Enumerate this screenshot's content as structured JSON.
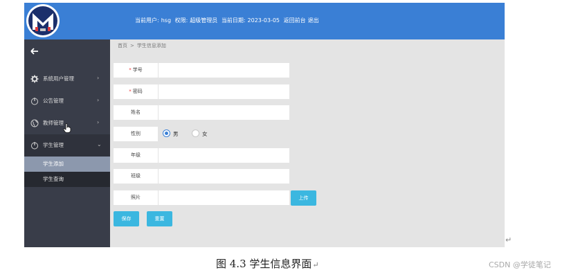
{
  "header": {
    "current_user_label": "当前用户:",
    "current_user": "hsg",
    "role_label": "权限:",
    "role": "超级管理员",
    "date_label": "当前日期:",
    "date": "2023-03-05",
    "back_front_link": "返回前台",
    "logout_link": "退出",
    "header_color": "#3a7fd5"
  },
  "sidebar": {
    "back_icon": "arrow-left-icon",
    "items": [
      {
        "label": "系统用户管理",
        "icon": "gear-icon",
        "arrow": "›"
      },
      {
        "label": "公告管理",
        "icon": "power-icon",
        "arrow": "›"
      },
      {
        "label": "教师管理",
        "icon": "globe-icon",
        "arrow": "›"
      },
      {
        "label": "学生管理",
        "icon": "power-icon",
        "arrow": "⌄"
      }
    ],
    "subitems": [
      {
        "label": "学生添加",
        "active": true
      },
      {
        "label": "学生查询",
        "active": false
      }
    ]
  },
  "breadcrumb": {
    "home": "首页",
    "separator": ">",
    "current": "学生信息添加"
  },
  "form": {
    "student_no": {
      "label": "学号",
      "required": true,
      "value": ""
    },
    "password": {
      "label": "密码",
      "required": true,
      "value": ""
    },
    "name": {
      "label": "姓名",
      "value": ""
    },
    "gender": {
      "label": "性别",
      "options": [
        "男",
        "女"
      ],
      "selected": "男"
    },
    "grade": {
      "label": "年级",
      "value": ""
    },
    "class": {
      "label": "班级",
      "value": ""
    },
    "photo": {
      "label": "照片",
      "value": ""
    },
    "required_mark": "*"
  },
  "buttons": {
    "upload": "上传",
    "save": "保存",
    "reset": "重置",
    "button_color": "#3bb7e0"
  },
  "caption": {
    "text": "图 4.3  学生信息界面",
    "mark": "↵"
  },
  "return_mark": "↵",
  "watermark": "CSDN @学徒笔记"
}
